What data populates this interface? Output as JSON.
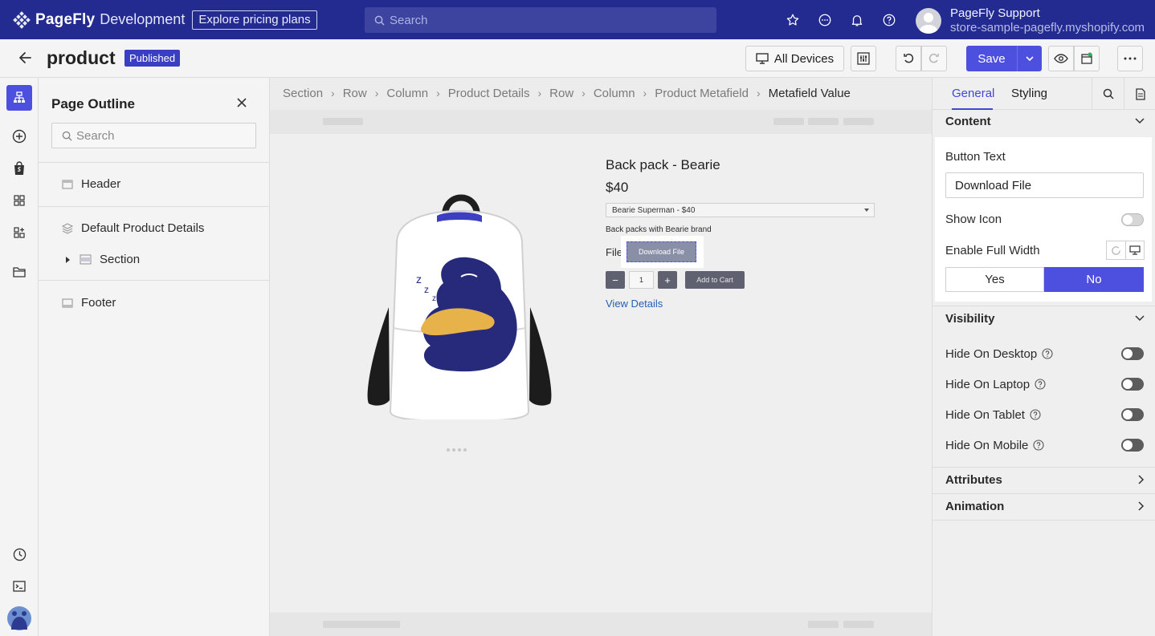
{
  "topbar": {
    "brand": "PageFly",
    "environment": "Development",
    "pricing_button": "Explore pricing plans",
    "search_placeholder": "Search",
    "icons": [
      "star-icon",
      "chat-icon",
      "bell-icon",
      "help-icon"
    ],
    "user_name": "PageFly Support",
    "user_store": "store-sample-pagefly.myshopify.com"
  },
  "header": {
    "page_title": "product",
    "status": "Published",
    "devices_label": "All Devices",
    "save_label": "Save"
  },
  "rail": {
    "icons": [
      "sitemap-icon",
      "add-circle-icon",
      "shopify-bag-icon",
      "grid-icon",
      "blocks-add-icon",
      "folder-icon",
      "history-icon",
      "terminal-icon",
      "avatar-icon"
    ]
  },
  "outline": {
    "title": "Page Outline",
    "search_placeholder": "Search",
    "items": [
      {
        "label": "Header"
      },
      {
        "label": "Default Product Details"
      },
      {
        "label": "Section"
      },
      {
        "label": "Footer"
      }
    ]
  },
  "breadcrumb": [
    "Section",
    "Row",
    "Column",
    "Product Details",
    "Row",
    "Column",
    "Product Metafield",
    "Metafield Value"
  ],
  "product": {
    "title": "Back pack - Bearie",
    "price": "$40",
    "variant": "Bearie Superman - $40",
    "description": "Back packs with Bearie brand",
    "file_label": "File",
    "download_button": "Download File",
    "qty_minus": "−",
    "quantity": "1",
    "qty_plus": "+",
    "add_to_cart": "Add to Cart",
    "view_details": "View Details"
  },
  "inspector": {
    "tabs": [
      "General",
      "Styling"
    ],
    "content_section": "Content",
    "button_text_label": "Button Text",
    "button_text_value": "Download File",
    "show_icon_label": "Show Icon",
    "show_icon_on": false,
    "full_width_label": "Enable Full Width",
    "yes_label": "Yes",
    "no_label": "No",
    "full_width_selected": "No",
    "visibility_section": "Visibility",
    "visibility_items": [
      {
        "label": "Hide On Desktop",
        "on": false
      },
      {
        "label": "Hide On Laptop",
        "on": false
      },
      {
        "label": "Hide On Tablet",
        "on": false
      },
      {
        "label": "Hide On Mobile",
        "on": false
      }
    ],
    "attributes_section": "Attributes",
    "animation_section": "Animation"
  },
  "colors": {
    "topbar_bg": "#232b90",
    "accent": "#4d50df",
    "link": "#2560b4"
  }
}
